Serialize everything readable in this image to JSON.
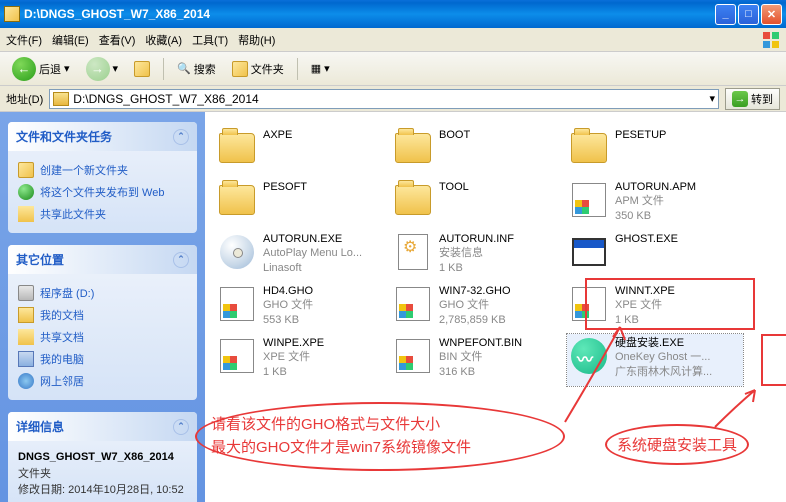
{
  "window": {
    "title": "D:\\DNGS_GHOST_W7_X86_2014"
  },
  "menu": {
    "file": "文件(F)",
    "edit": "编辑(E)",
    "view": "查看(V)",
    "fav": "收藏(A)",
    "tools": "工具(T)",
    "help": "帮助(H)"
  },
  "toolbar": {
    "back": "后退",
    "search": "搜索",
    "folders": "文件夹"
  },
  "address": {
    "label": "地址(D)",
    "path": "D:\\DNGS_GHOST_W7_X86_2014",
    "go": "转到"
  },
  "panels": {
    "tasks": {
      "title": "文件和文件夹任务",
      "items": [
        "创建一个新文件夹",
        "将这个文件夹发布到 Web",
        "共享此文件夹"
      ]
    },
    "other": {
      "title": "其它位置",
      "items": [
        "程序盘 (D:)",
        "我的文档",
        "共享文档",
        "我的电脑",
        "网上邻居"
      ]
    },
    "details": {
      "title": "详细信息",
      "name": "DNGS_GHOST_W7_X86_2014",
      "type": "文件夹",
      "mod_label": "修改日期:",
      "mod": "2014年10月28日, 10:52"
    }
  },
  "files": [
    {
      "name": "AXPE",
      "kind": "folder"
    },
    {
      "name": "BOOT",
      "kind": "folder"
    },
    {
      "name": "PESETUP",
      "kind": "folder"
    },
    {
      "name": "PESOFT",
      "kind": "folder"
    },
    {
      "name": "TOOL",
      "kind": "folder"
    },
    {
      "name": "AUTORUN.APM",
      "kind": "app",
      "sub1": "APM 文件",
      "sub2": "350 KB"
    },
    {
      "name": "AUTORUN.EXE",
      "kind": "cd",
      "sub1": "AutoPlay Menu Lo...",
      "sub2": "Linasoft"
    },
    {
      "name": "AUTORUN.INF",
      "kind": "inf",
      "sub1": "安装信息",
      "sub2": "1 KB"
    },
    {
      "name": "GHOST.EXE",
      "kind": "win"
    },
    {
      "name": "HD4.GHO",
      "kind": "app",
      "sub1": "GHO 文件",
      "sub2": "553 KB"
    },
    {
      "name": "WIN7-32.GHO",
      "kind": "app",
      "sub1": "GHO 文件",
      "sub2": "2,785,859 KB"
    },
    {
      "name": "WINNT.XPE",
      "kind": "app",
      "sub1": "XPE 文件",
      "sub2": "1 KB"
    },
    {
      "name": "WINPE.XPE",
      "kind": "app",
      "sub1": "XPE 文件",
      "sub2": "1 KB"
    },
    {
      "name": "WNPEFONT.BIN",
      "kind": "app",
      "sub1": "BIN 文件",
      "sub2": "316 KB"
    },
    {
      "name": "硬盘安装.EXE",
      "kind": "green",
      "sub1": "OneKey Ghost 一...",
      "sub2": "广东雨林木风计算...",
      "selected": true
    }
  ],
  "annotations": {
    "line1": "请看该文件的GHO格式与文件大小",
    "line2": "最大的GHO文件才是win7系统镜像文件",
    "tool": "系统硬盘安装工具"
  }
}
